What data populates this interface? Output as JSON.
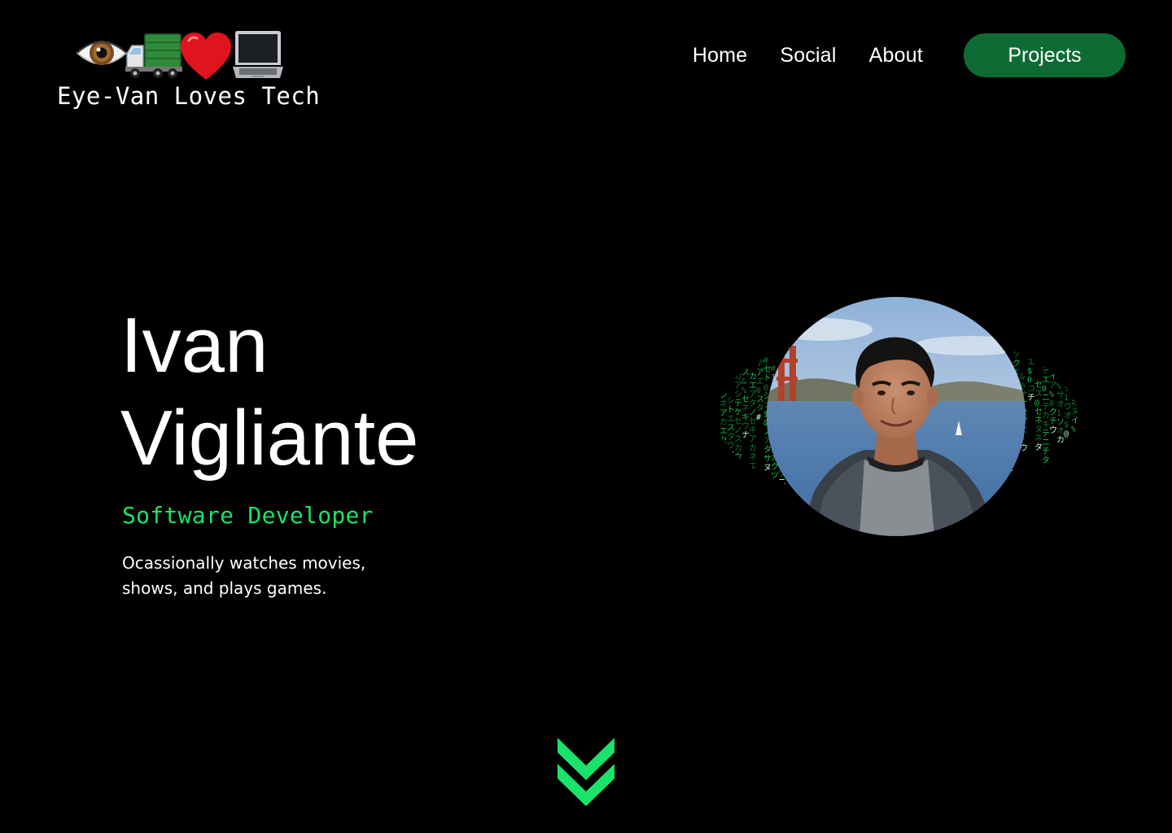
{
  "logo": {
    "icons": [
      "eye-icon",
      "truck-icon",
      "heart-icon",
      "laptop-icon"
    ],
    "text": "Eye-Van Loves Tech"
  },
  "nav": {
    "items": [
      {
        "label": "Home"
      },
      {
        "label": "Social"
      },
      {
        "label": "About"
      }
    ],
    "cta_label": "Projects"
  },
  "hero": {
    "first_name": "Ivan",
    "last_name": "Vigliante",
    "role": "Software Developer",
    "description": "Ocassionally watches movies, shows, and plays games."
  },
  "portrait": {
    "image": "profile-photo",
    "background": "matrix-code-rain"
  },
  "scroll": {
    "icon": "double-chevron-down-icon"
  },
  "colors": {
    "background": "#000000",
    "text": "#ffffff",
    "accent_green": "#19e36a",
    "button_green": "#0f6b34"
  }
}
